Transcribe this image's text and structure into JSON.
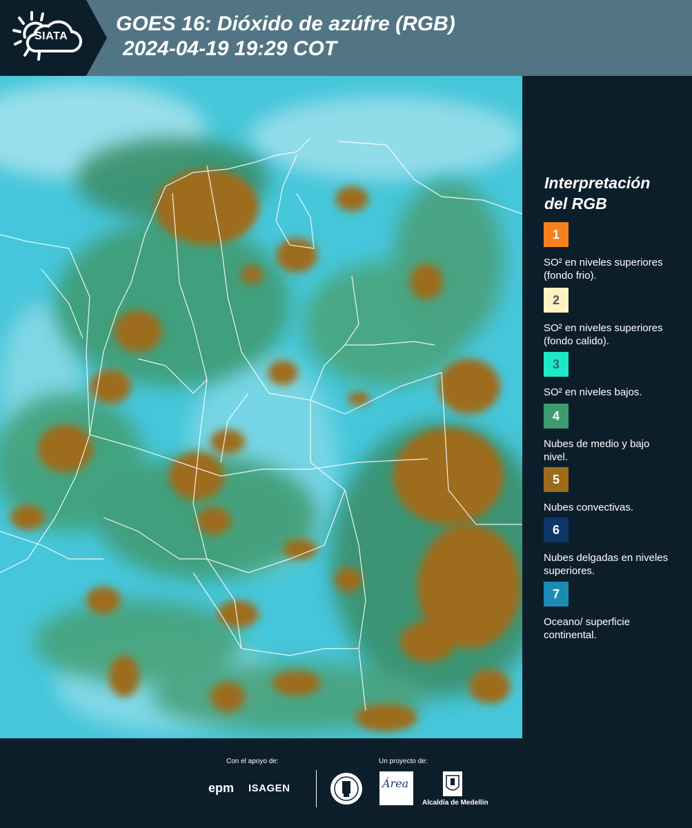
{
  "header": {
    "logo_text": "SIATA",
    "title_line1": "GOES 16: Dióxido de azúfre (RGB)",
    "title_line2": "2024-04-19 19:29 COT"
  },
  "legend": {
    "title_line1": "Interpretación",
    "title_line2": "del RGB",
    "items": [
      {
        "number": "1",
        "color": "#f5821f",
        "number_color": "#ffffff",
        "text": "SO² en niveles superiores (fondo frio)."
      },
      {
        "number": "2",
        "color": "#fef3c0",
        "number_color": "#555555",
        "text": "SO² en niveles superiores (fondo calido)."
      },
      {
        "number": "3",
        "color": "#1de9c9",
        "number_color": "#336666",
        "text": "SO² en niveles bajos."
      },
      {
        "number": "4",
        "color": "#3f9b72",
        "number_color": "#ffffff",
        "text": "Nubes de medio y bajo nivel."
      },
      {
        "number": "5",
        "color": "#9d6c1a",
        "number_color": "#ffffff",
        "text": "Nubes convectivas."
      },
      {
        "number": "6",
        "color": "#0d3768",
        "number_color": "#ffffff",
        "text": "Nubes delgadas en niveles superiores."
      },
      {
        "number": "7",
        "color": "#1c8bb3",
        "number_color": "#ffffff",
        "text": "Oceano/ superficie continental."
      }
    ]
  },
  "footer": {
    "support_label": "Con el apoyo de:",
    "epm": "epm",
    "isagen": "ISAGEN",
    "project_label": "Un proyecto de:",
    "area_text": "Área",
    "alcaldia": "Alcaldía de Medellín"
  }
}
